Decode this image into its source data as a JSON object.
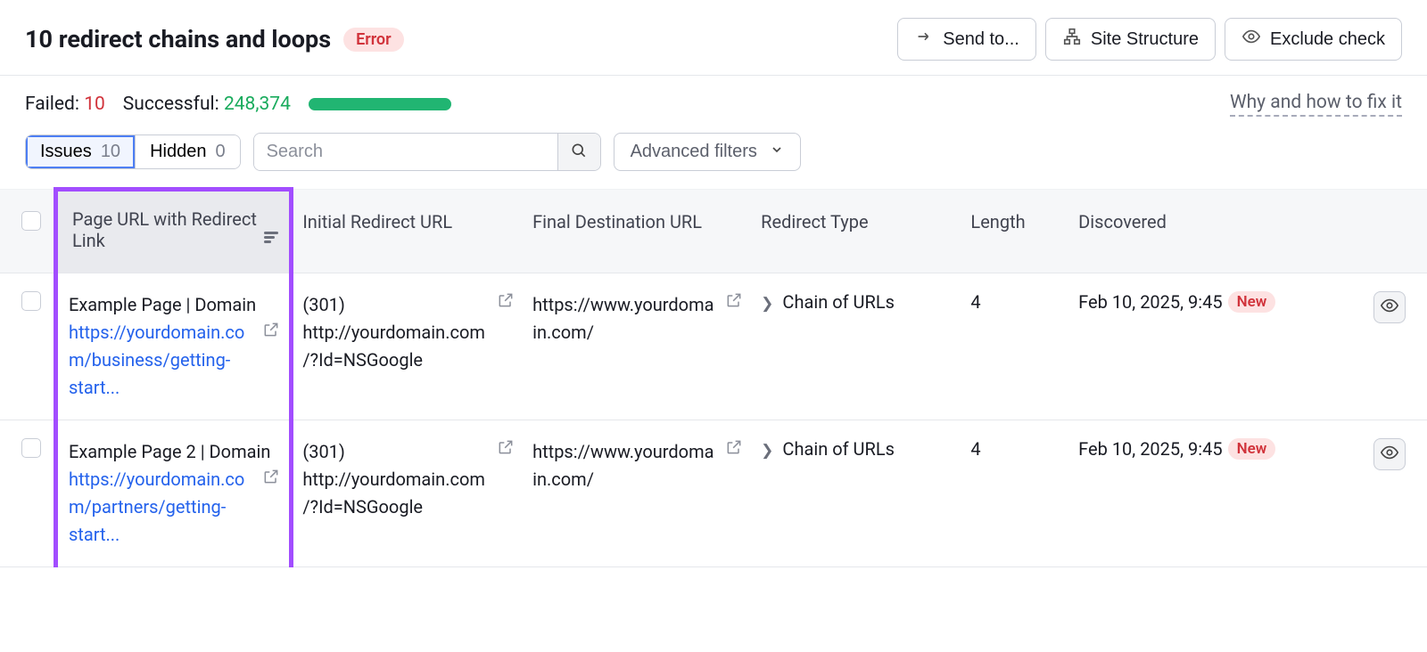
{
  "header": {
    "title": "10 redirect chains and loops",
    "error_badge": "Error",
    "send_to": "Send to...",
    "site_structure": "Site Structure",
    "exclude_check": "Exclude check"
  },
  "stats": {
    "failed_label": "Failed:",
    "failed_count": "10",
    "successful_label": "Successful:",
    "successful_count": "248,374",
    "fix_link": "Why and how to fix it"
  },
  "filters": {
    "issues_label": "Issues",
    "issues_count": "10",
    "hidden_label": "Hidden",
    "hidden_count": "0",
    "search_placeholder": "Search",
    "advanced": "Advanced filters"
  },
  "columns": {
    "page_url": "Page URL with Redirect Link",
    "initial": "Initial Redirect URL",
    "final": "Final Destination URL",
    "type": "Redirect Type",
    "length": "Length",
    "discovered": "Discovered"
  },
  "rows": [
    {
      "title": "Example Page | Domain",
      "url": "https://yourdomain.com/business/getting-start...",
      "initial": "(301) http://yourdomain.com/?Id=NSGoogle",
      "final": "https://www.yourdomain.com/",
      "type": "Chain of URLs",
      "length": "4",
      "discovered": "Feb 10, 2025, 9:45",
      "new": "New"
    },
    {
      "title": "Example Page 2 | Domain",
      "url": "https://yourdomain.com/partners/getting-start...",
      "initial": "(301) http://yourdomain.com/?Id=NSGoogle",
      "final": "https://www.yourdomain.com/",
      "type": "Chain of URLs",
      "length": "4",
      "discovered": "Feb 10, 2025, 9:45",
      "new": "New"
    }
  ]
}
